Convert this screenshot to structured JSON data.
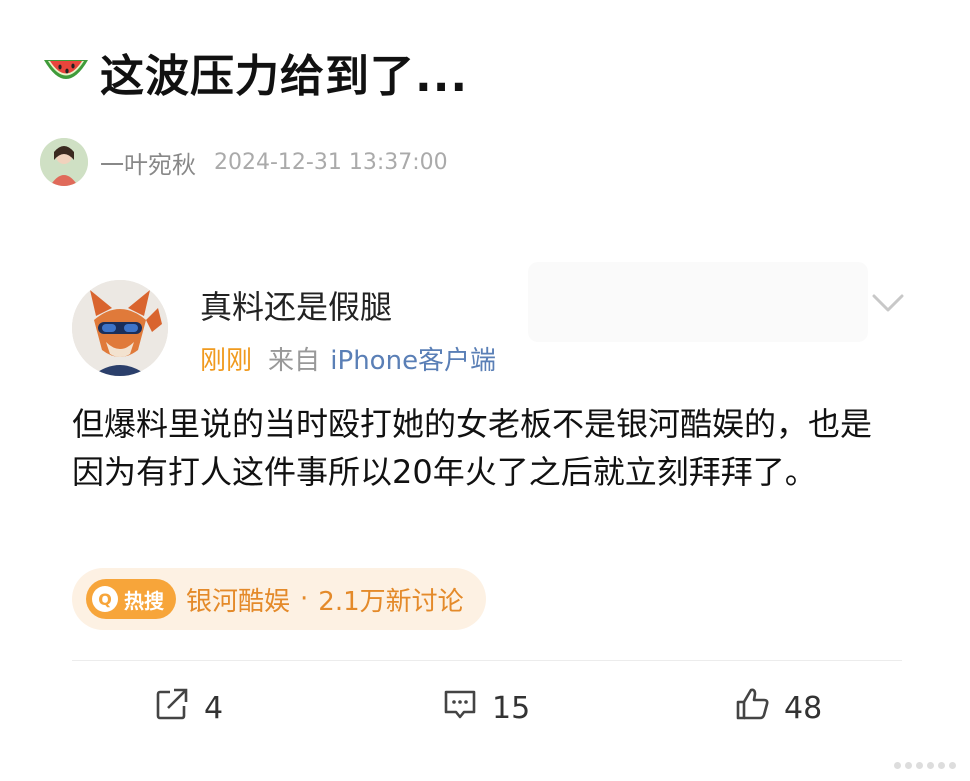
{
  "header": {
    "emoji_icon": "watermelon-icon",
    "title": "这波压力给到了..."
  },
  "author": {
    "name": "一叶宛秋",
    "timestamp": "2024-12-31 13:37:00"
  },
  "post": {
    "username": "真料还是假腿",
    "time": "刚刚",
    "from_label": "来自",
    "source": "iPhone客户端",
    "body": "但爆料里说的当时殴打她的女老板不是银河酷娱的，也是因为有打人这件事所以20年火了之后就立刻拜拜了。",
    "hot_search": {
      "badge": "热搜",
      "topic": "银河酷娱",
      "separator": " · ",
      "discussions": "2.1万新讨论"
    },
    "actions": {
      "share_count": "4",
      "comment_count": "15",
      "like_count": "48"
    }
  },
  "colors": {
    "accent_orange": "#f09a1e",
    "source_blue": "#5a7fb6",
    "hot_bg": "#fdf1e3"
  }
}
